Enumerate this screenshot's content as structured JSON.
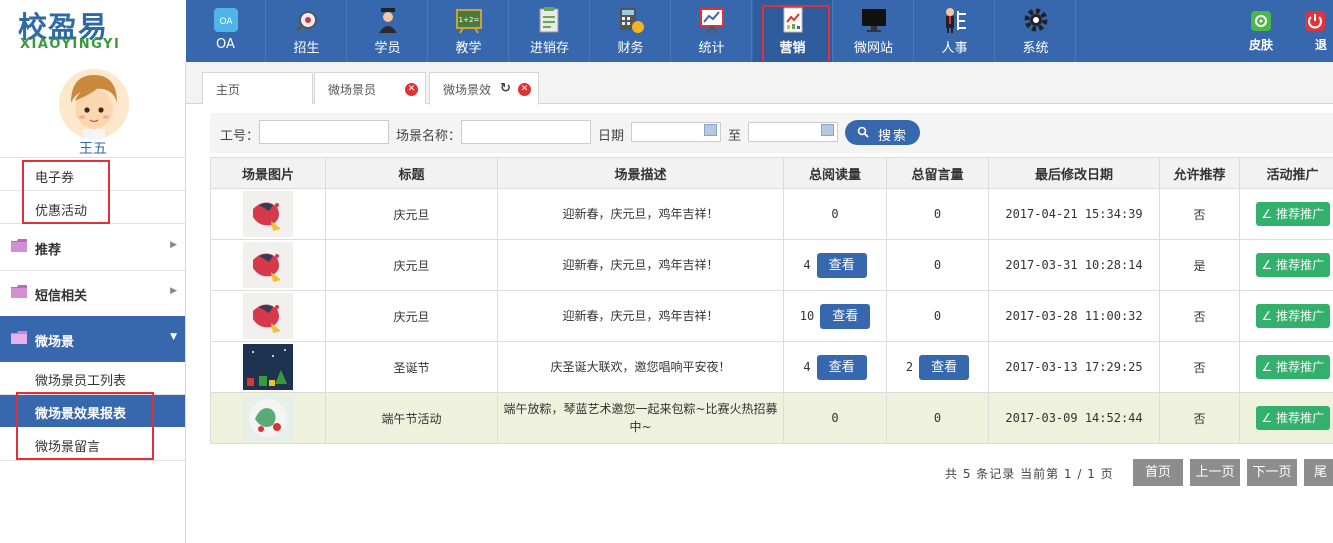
{
  "logo": {
    "cn": "校盈易",
    "en": "XIAOYINGYI"
  },
  "nav": [
    {
      "label": "OA",
      "icon": "oa-icon"
    },
    {
      "label": "招生",
      "icon": "enroll-icon"
    },
    {
      "label": "学员",
      "icon": "student-icon"
    },
    {
      "label": "教学",
      "icon": "teaching-icon"
    },
    {
      "label": "进销存",
      "icon": "inventory-icon"
    },
    {
      "label": "财务",
      "icon": "finance-icon"
    },
    {
      "label": "统计",
      "icon": "stats-icon"
    },
    {
      "label": "营销",
      "icon": "marketing-icon"
    },
    {
      "label": "微网站",
      "icon": "microsite-icon"
    },
    {
      "label": "人事",
      "icon": "hr-icon"
    },
    {
      "label": "系统",
      "icon": "system-icon"
    }
  ],
  "nav_right": {
    "skin": "皮肤",
    "logout": "退"
  },
  "user": {
    "name": "王五"
  },
  "sidebar": {
    "links": [
      "电子券",
      "优惠活动"
    ],
    "sections": [
      "推荐",
      "短信相关",
      "微场景"
    ],
    "subitems": [
      "微场景员工列表",
      "微场景效果报表",
      "微场景留言"
    ]
  },
  "tabs": [
    {
      "label": "主页"
    },
    {
      "label": "微场景员"
    },
    {
      "label": "微场景效"
    }
  ],
  "search": {
    "emp_label": "工号：",
    "scene_label": "场景名称：",
    "date_label": "日期",
    "to_label": "至",
    "button": "搜索"
  },
  "table": {
    "headers": [
      "场景图片",
      "标题",
      "场景描述",
      "总阅读量",
      "总留言量",
      "最后修改日期",
      "允许推荐",
      "活动推广"
    ],
    "view_label": "查看",
    "promo_label": "推荐推广",
    "rows": [
      {
        "title": "庆元旦",
        "desc": "迎新春，庆元旦，鸡年吉祥！",
        "reads": "0",
        "reads_view": false,
        "msgs": "0",
        "msgs_view": false,
        "date": "2017-04-21 15:34:39",
        "recommend": "否"
      },
      {
        "title": "庆元旦",
        "desc": "迎新春，庆元旦，鸡年吉祥！",
        "reads": "4",
        "reads_view": true,
        "msgs": "0",
        "msgs_view": false,
        "date": "2017-03-31 10:28:14",
        "recommend": "是"
      },
      {
        "title": "庆元旦",
        "desc": "迎新春，庆元旦，鸡年吉祥！",
        "reads": "10",
        "reads_view": true,
        "msgs": "0",
        "msgs_view": false,
        "date": "2017-03-28 11:00:32",
        "recommend": "否"
      },
      {
        "title": "圣诞节",
        "desc": "庆圣诞大联欢，邀您唱响平安夜！",
        "reads": "4",
        "reads_view": true,
        "msgs": "2",
        "msgs_view": true,
        "date": "2017-03-13 17:29:25",
        "recommend": "否"
      },
      {
        "title": "端午节活动",
        "desc": "端午放粽，琴蓝艺术邀您一起来包粽~比赛火热招募中~",
        "reads": "0",
        "reads_view": false,
        "msgs": "0",
        "msgs_view": false,
        "date": "2017-03-09 14:52:44",
        "recommend": "否"
      }
    ]
  },
  "pager": {
    "summary": "共 5 条记录 当前第 1 / 1 页",
    "first": "首页",
    "prev": "上一页",
    "next": "下一页",
    "last": "尾页"
  },
  "colors": {
    "primary": "#3767ad",
    "success": "#32b06c",
    "highlight": "#e0303a",
    "pager": "#8d8d8d"
  }
}
